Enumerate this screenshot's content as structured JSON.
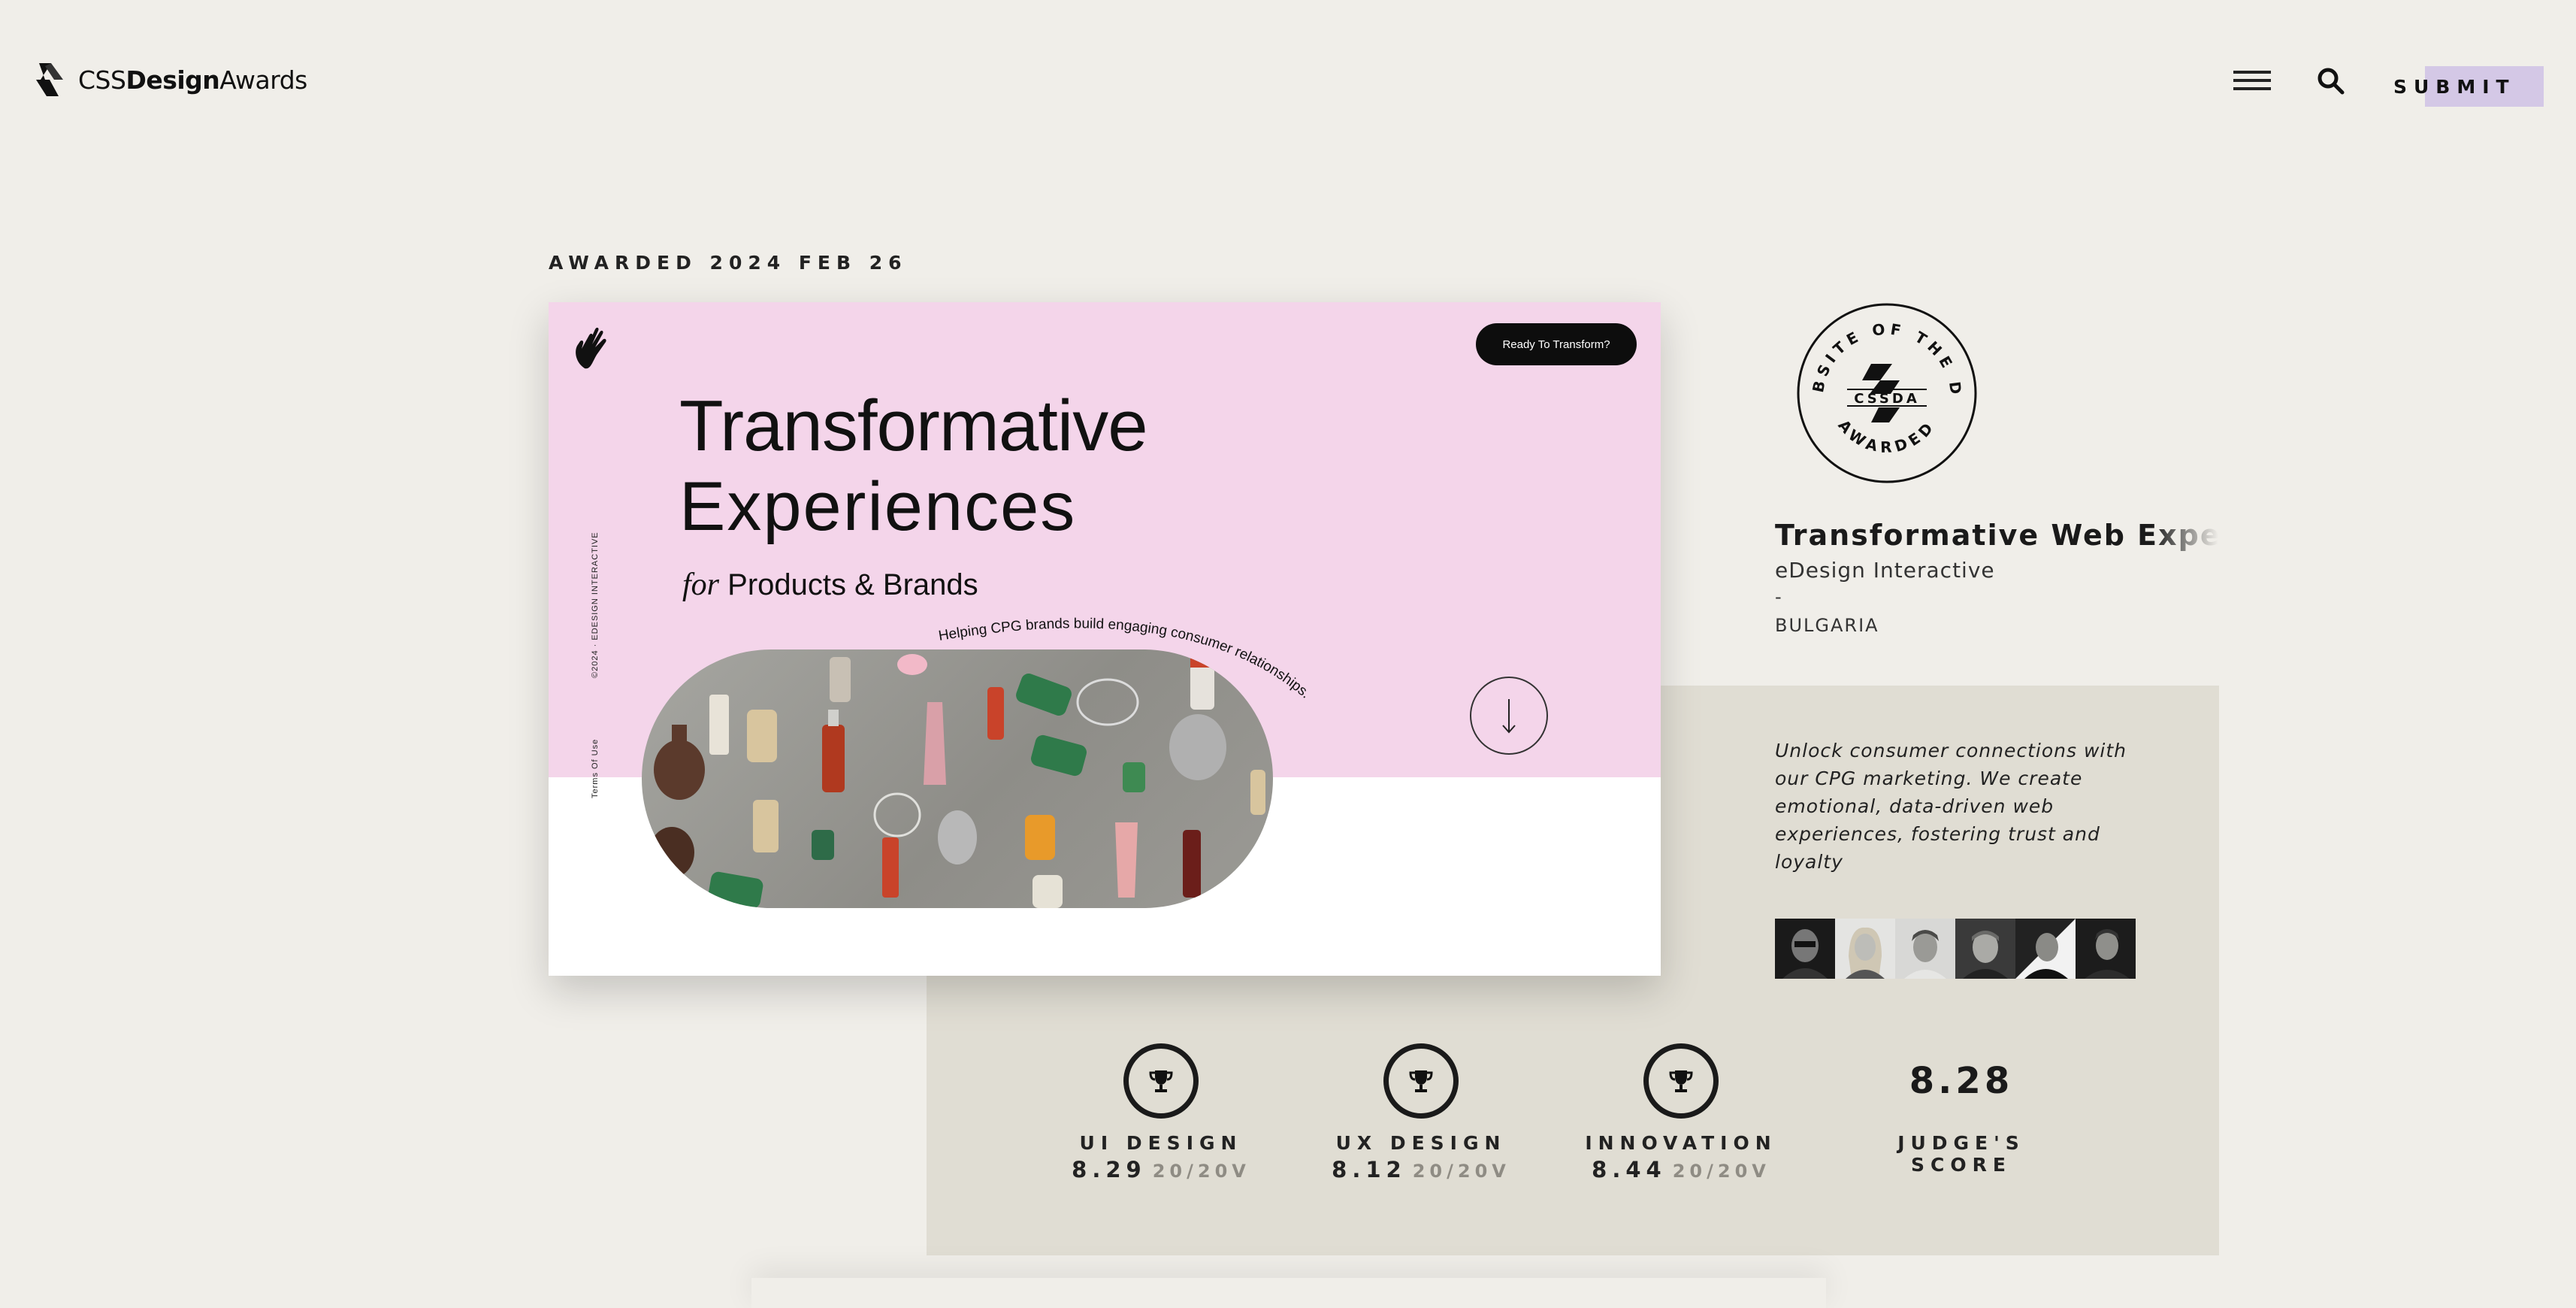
{
  "header": {
    "brand": {
      "part1": "CSS",
      "part2": "Design",
      "part3": "Awards"
    },
    "submit_label": "SUBMIT"
  },
  "award": {
    "date_label": "AWARDED 2024 FEB 26"
  },
  "screenshot": {
    "cta": "Ready To Transform?",
    "headline1": "Transformative",
    "headline2": "Experiences",
    "sub_for": "for",
    "sub_text": "Products & Brands",
    "curve_text": "Helping CPG brands build engaging consumer relationships.",
    "vertical_1": "Terms Of Use",
    "vertical_2": "©2024 · EDESIGN INTERACTIVE"
  },
  "badge": {
    "top_text": "WEBSITE OF THE DAY",
    "center_text": "CSSDA",
    "bottom_text": "AWARDED"
  },
  "site": {
    "title": "Transformative Web Experiences",
    "agency": "eDesign Interactive",
    "dash": "-",
    "country": "BULGARIA",
    "description": "Unlock consumer connections with our CPG marketing. We create emotional, data-driven web experiences, fostering trust and loyalty"
  },
  "scores": [
    {
      "label": "UI DESIGN",
      "value": "8.29",
      "votes": "20/20V"
    },
    {
      "label": "UX DESIGN",
      "value": "8.12",
      "votes": "20/20V"
    },
    {
      "label": "INNOVATION",
      "value": "8.44",
      "votes": "20/20V"
    }
  ],
  "judge_score": {
    "value": "8.28",
    "label": "JUDGE'S SCORE"
  },
  "colors": {
    "page_bg": "#f0eee9",
    "panel_bg": "#e0ddd3",
    "submit_highlight": "#d4c8e6",
    "shot_pink": "#f4d5ea"
  }
}
